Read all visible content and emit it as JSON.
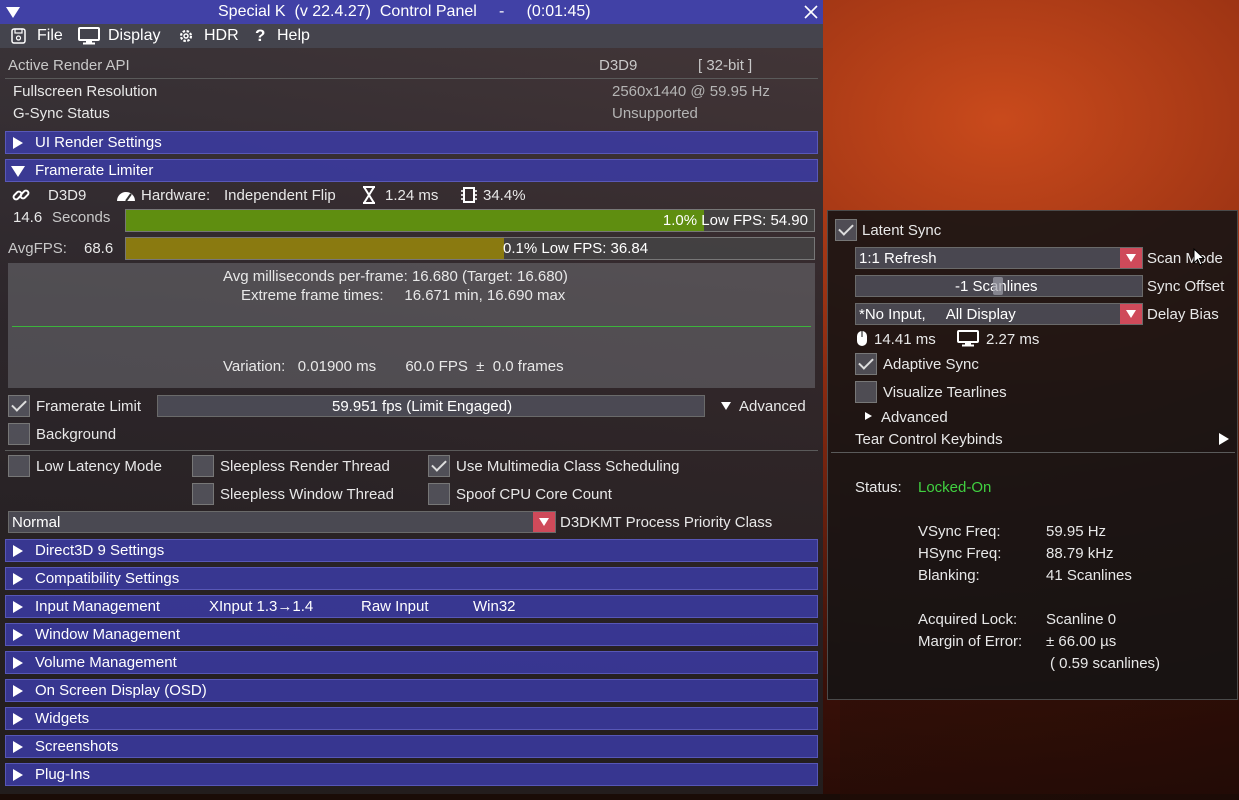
{
  "window": {
    "title": "Special K  (v 22.4.27)  Control Panel     -     (0:01:45)"
  },
  "menu": {
    "file": "File",
    "display": "Display",
    "hdr": "HDR",
    "help": "Help"
  },
  "info": {
    "api_label": "Active Render API",
    "api_value": "D3D9",
    "api_bits": "[ 32-bit ]",
    "res_label": "Fullscreen Resolution",
    "res_value": "2560x1440 @  59.95 Hz",
    "gsync_label": "G-Sync Status",
    "gsync_value": "Unsupported"
  },
  "sections": {
    "ui_render": "UI Render Settings",
    "framerate_limiter": "Framerate Limiter",
    "d3d9": "Direct3D 9 Settings",
    "compat": "Compatibility Settings",
    "input": "Input Management",
    "input_tags": [
      "XInput 1.3→1.4",
      "Raw Input",
      "Win32"
    ],
    "window": "Window Management",
    "volume": "Volume Management",
    "osd": "On Screen Display (OSD)",
    "widgets": "Widgets",
    "screenshots": "Screenshots",
    "plugins": "Plug-Ins"
  },
  "limiter": {
    "api": "D3D9",
    "hardware_label": "Hardware:",
    "hardware_value": "Independent Flip",
    "latency": "1.24 ms",
    "cpu": "34.4%",
    "seconds_value": "14.6",
    "seconds_label": "Seconds",
    "low1_text": "1.0% Low FPS: 54.90",
    "avgfps_label": "AvgFPS:",
    "avgfps_value": "68.6",
    "low01_text": "0.1% Low FPS: 36.84",
    "avg_ms_text": "Avg milliseconds per-frame: 16.680  (Target: 16.680)",
    "extreme_text": "Extreme frame times:     16.671 min, 16.690 max",
    "variation_text": "Variation:   0.01900 ms       60.0 FPS  ±  0.0 frames",
    "framerate_limit_label": "Framerate Limit",
    "framerate_limit_value": "59.951 fps  (Limit Engaged)",
    "advanced_label": "Advanced",
    "background_label": "Background",
    "low_latency_label": "Low Latency Mode",
    "sleepless_render_label": "Sleepless Render Thread",
    "mmcss_label": "Use Multimedia Class Scheduling",
    "sleepless_window_label": "Sleepless Window Thread",
    "spoof_cpu_label": "Spoof CPU Core Count",
    "priority_value": "Normal",
    "priority_label": "D3DKMT Process Priority Class",
    "low1_fraction": 0.84,
    "low01_fraction": 0.55
  },
  "latent": {
    "latent_sync_label": "Latent Sync",
    "scan_mode_value": "1:1 Refresh",
    "scan_mode_label": "Scan Mode",
    "sync_offset_value": "-1 Scanlines",
    "sync_offset_label": "Sync Offset",
    "delay_bias_value": "*No Input,     All Display",
    "delay_bias_label": "Delay Bias",
    "input_ms": "14.41 ms",
    "display_ms": "2.27 ms",
    "adaptive_label": "Adaptive Sync",
    "tearlines_label": "Visualize Tearlines",
    "advanced_label": "Advanced",
    "keybinds_label": "Tear Control Keybinds",
    "status_label": "Status:",
    "status_value": "Locked-On",
    "vsync_label": "VSync Freq:",
    "vsync_value": "59.95 Hz",
    "hsync_label": "HSync Freq:",
    "hsync_value": "88.79 kHz",
    "blank_label": "Blanking:",
    "blank_value": "41 Scanlines",
    "lock_label": "Acquired Lock:",
    "lock_value": "Scanline 0",
    "moe_label": "Margin of Error:",
    "moe_value": "± 66.00 µs",
    "moe_sub": "( 0.59 scanlines)"
  },
  "colors": {
    "header": "#4141a6",
    "green": "#40d040",
    "bar1": "#5f8e10",
    "bar2": "#8a7a10",
    "dropdown": "#cf4a5a"
  }
}
